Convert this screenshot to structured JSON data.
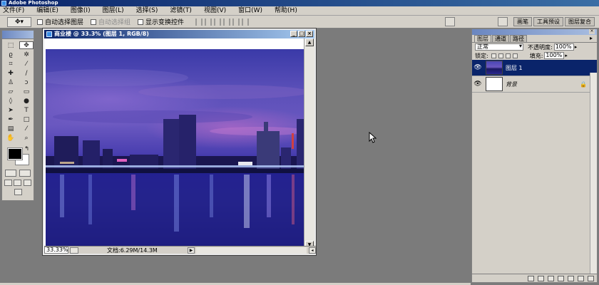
{
  "app": {
    "title": "Adobe Photoshop"
  },
  "menu": [
    "文件(F)",
    "编辑(E)",
    "图像(I)",
    "图层(L)",
    "选择(S)",
    "滤镜(T)",
    "视图(V)",
    "窗口(W)",
    "帮助(H)"
  ],
  "options": {
    "auto_select_layer": "自动选择图层",
    "auto_select_group": "自动选择组",
    "show_transform": "显示变换控件",
    "dock_tabs": [
      "画笔",
      "工具预设",
      "图层复合"
    ]
  },
  "document": {
    "title": "商业楼 @ 33.3% (图层 1, RGB/8)",
    "zoom": "33.33%",
    "info": "文档:6.29M/14.3M"
  },
  "layers_panel": {
    "tabs": [
      "图层",
      "通道",
      "路径"
    ],
    "blend_mode": "正常",
    "opacity_label": "不透明度:",
    "opacity": "100%",
    "lock_label": "锁定:",
    "fill_label": "填充:",
    "fill": "100%",
    "layers": [
      {
        "name": "图层 1",
        "selected": true
      },
      {
        "name": "背景",
        "selected": false,
        "locked": true
      }
    ]
  }
}
